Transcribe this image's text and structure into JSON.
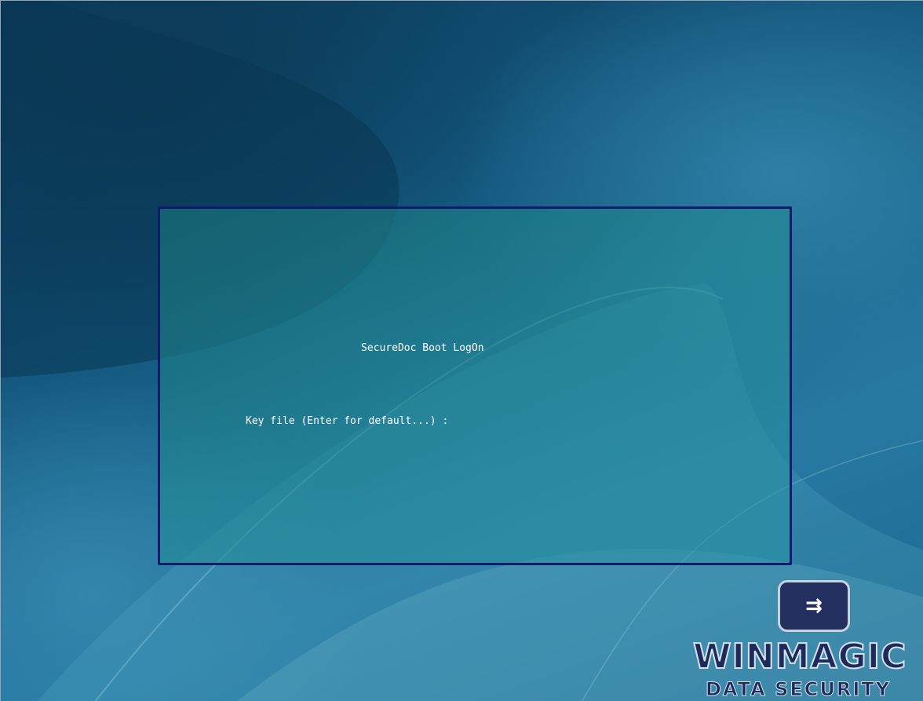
{
  "logon": {
    "title": "SecureDoc Boot LogOn",
    "prompt": "Key file (Enter for default...) :",
    "input_value": ""
  },
  "branding": {
    "logo_icon": "key-arrow-icon",
    "logo_glyph": "⇉",
    "name": "WINMAGIC",
    "tagline": "DATA SECURITY"
  },
  "colors": {
    "box_border": "#0d1a6e",
    "text": "#ffffff",
    "logo_navy": "#1c2a5c"
  }
}
